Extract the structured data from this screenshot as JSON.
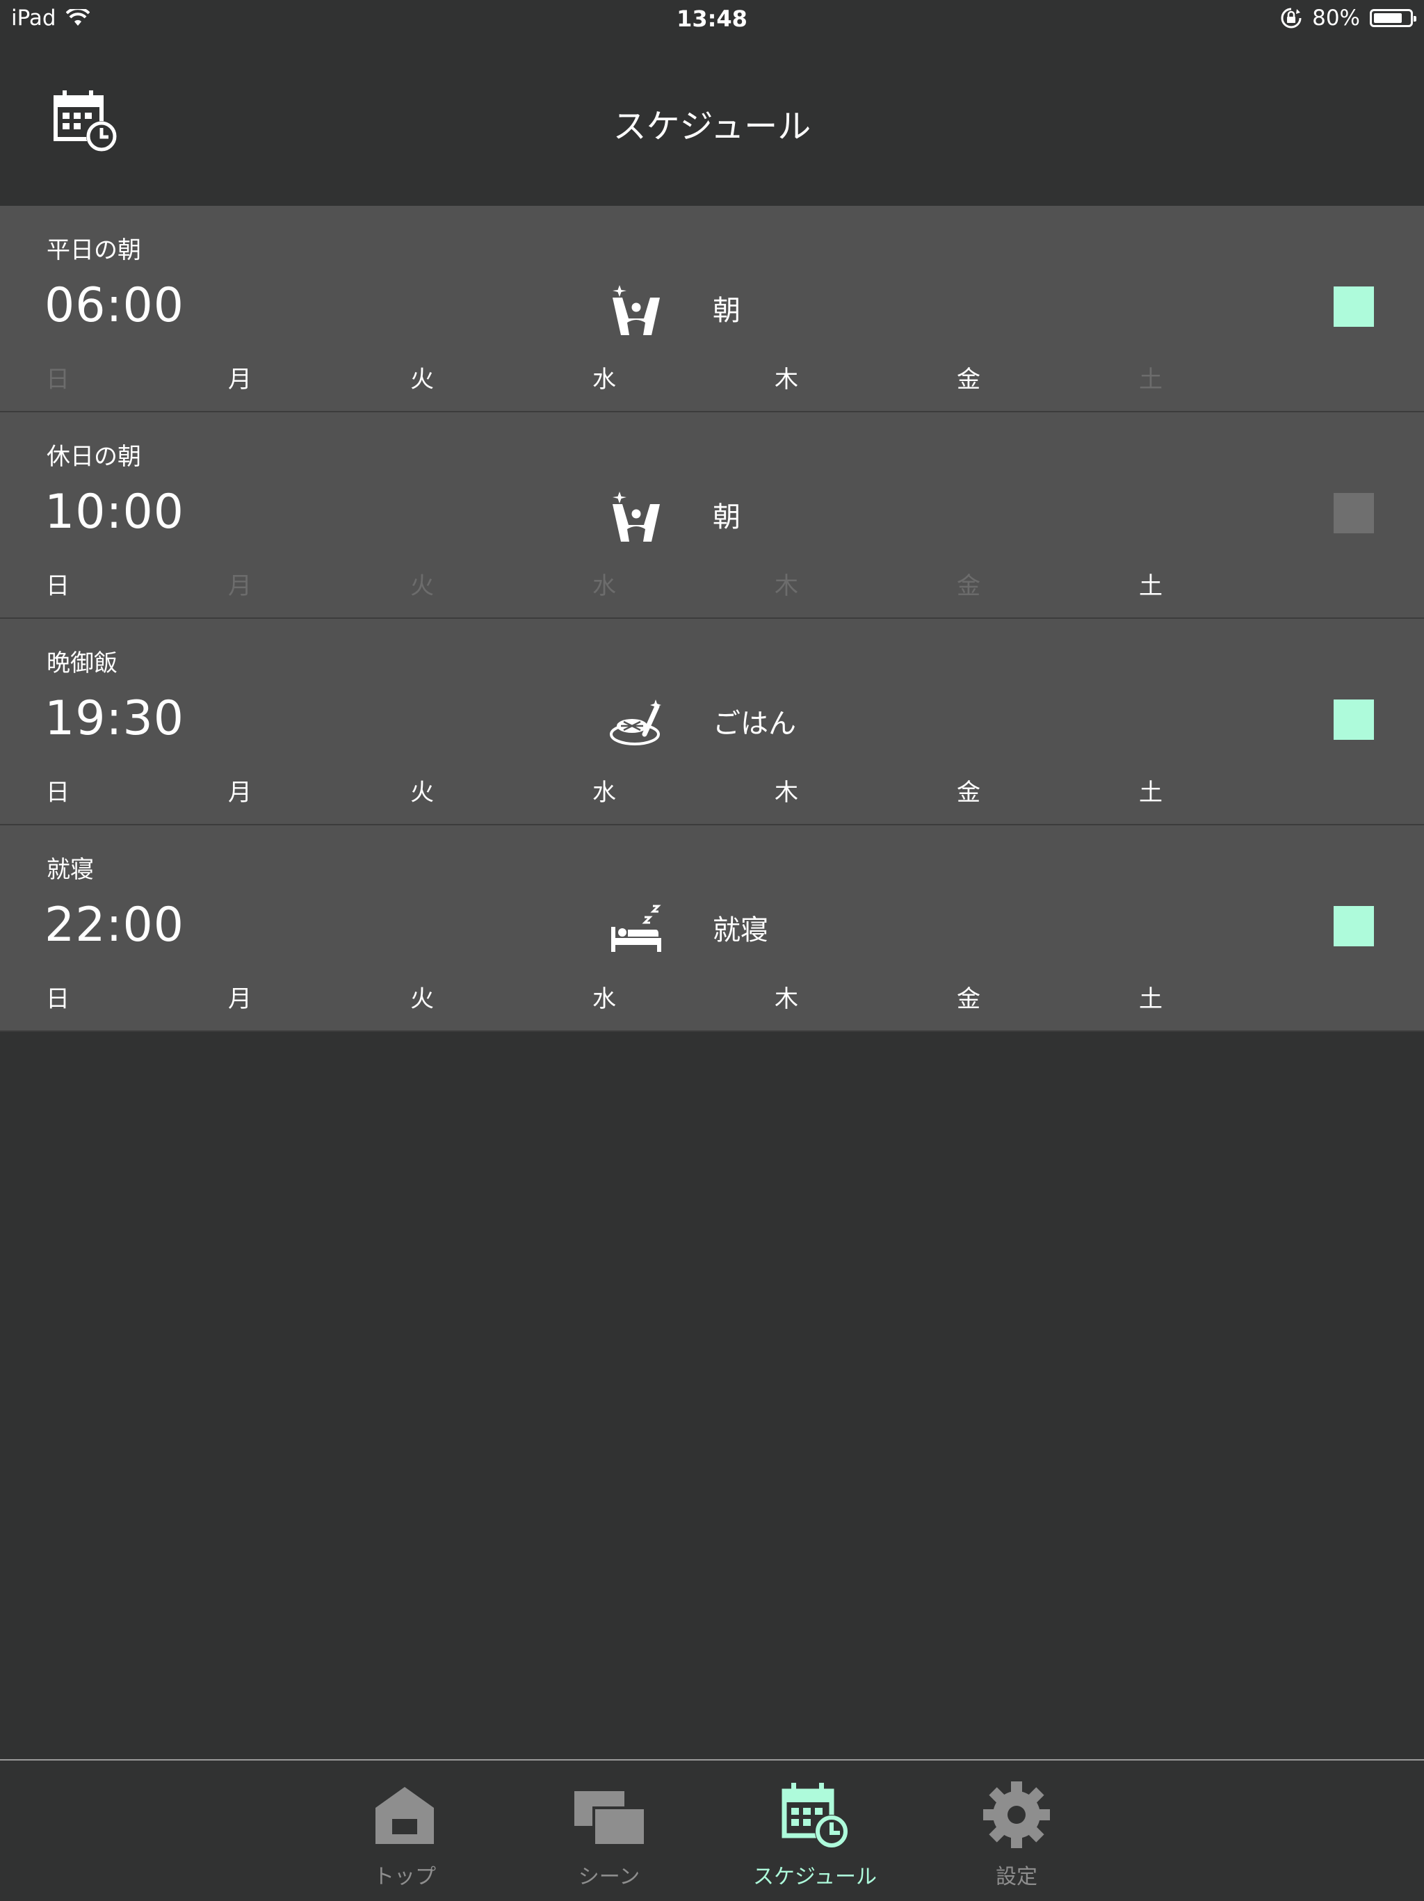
{
  "status_bar": {
    "device": "iPad",
    "time": "13:48",
    "battery_percent": "80%",
    "battery_level": 0.8
  },
  "header": {
    "title": "スケジュール",
    "icon": "calendar-clock-icon"
  },
  "colors": {
    "accent": "#aefbdb",
    "background": "#313232",
    "row_background": "#525252",
    "toggle_off": "#6f6f6f",
    "inactive_text": "#6c6c6c",
    "tab_inactive": "#8e8e8e"
  },
  "days": [
    "日",
    "月",
    "火",
    "水",
    "木",
    "金",
    "土"
  ],
  "schedules": [
    {
      "name": "平日の朝",
      "time": "06:00",
      "scene_icon": "morning-person-icon",
      "scene_label": "朝",
      "enabled": true,
      "active_days": [
        false,
        true,
        true,
        true,
        true,
        true,
        false
      ]
    },
    {
      "name": "休日の朝",
      "time": "10:00",
      "scene_icon": "morning-person-icon",
      "scene_label": "朝",
      "enabled": false,
      "active_days": [
        true,
        false,
        false,
        false,
        false,
        false,
        true
      ]
    },
    {
      "name": "晩御飯",
      "time": "19:30",
      "scene_icon": "meal-icon",
      "scene_label": "ごはん",
      "enabled": true,
      "active_days": [
        true,
        true,
        true,
        true,
        true,
        true,
        true
      ]
    },
    {
      "name": "就寝",
      "time": "22:00",
      "scene_icon": "sleep-bed-icon",
      "scene_label": "就寝",
      "enabled": true,
      "active_days": [
        true,
        true,
        true,
        true,
        true,
        true,
        true
      ]
    }
  ],
  "tabs": [
    {
      "label": "トップ",
      "icon": "home-icon",
      "active": false
    },
    {
      "label": "シーン",
      "icon": "scenes-icon",
      "active": false
    },
    {
      "label": "スケジュール",
      "icon": "calendar-clock-icon",
      "active": true
    },
    {
      "label": "設定",
      "icon": "gear-icon",
      "active": false
    }
  ]
}
